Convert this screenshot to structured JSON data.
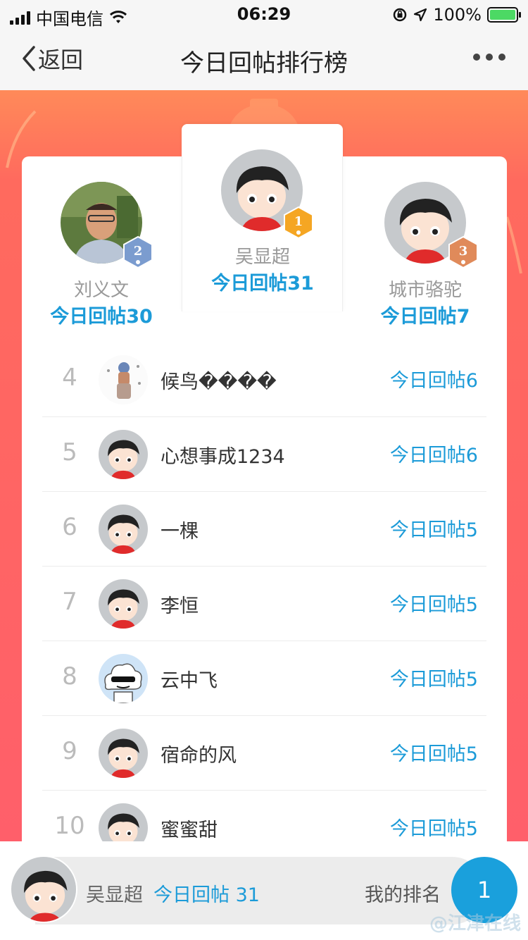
{
  "status_bar": {
    "carrier": "中国电信",
    "time": "06:29",
    "battery": "100%"
  },
  "nav": {
    "back_label": "返回",
    "title": "今日回帖排行榜"
  },
  "top3": [
    {
      "rank": "1",
      "name": "吴显超",
      "count": "今日回帖31"
    },
    {
      "rank": "2",
      "name": "刘义文",
      "count": "今日回帖30"
    },
    {
      "rank": "3",
      "name": "城市骆驼",
      "count": "今日回帖7"
    }
  ],
  "list": [
    {
      "rank": "4",
      "name": "候鸟����",
      "count": "今日回帖6",
      "avatar": "photo"
    },
    {
      "rank": "5",
      "name": "心想事成1234",
      "count": "今日回帖6",
      "avatar": "default"
    },
    {
      "rank": "6",
      "name": "一棵",
      "count": "今日回帖5",
      "avatar": "default"
    },
    {
      "rank": "7",
      "name": "李恒",
      "count": "今日回帖5",
      "avatar": "default"
    },
    {
      "rank": "8",
      "name": "云中飞",
      "count": "今日回帖5",
      "avatar": "cloud"
    },
    {
      "rank": "9",
      "name": "宿命的风",
      "count": "今日回帖5",
      "avatar": "default"
    },
    {
      "rank": "10",
      "name": "蜜蜜甜",
      "count": "今日回帖5",
      "avatar": "default"
    }
  ],
  "me": {
    "name": "吴显超",
    "count": "今日回帖 31",
    "rank_label": "我的排名",
    "rank": "1"
  },
  "watermark": "@江津在线",
  "colors": {
    "accent": "#1c9bd8",
    "background_red": "#ff5f6a",
    "gold_medal": "#f5a623",
    "silver_medal": "#7b9ccf",
    "bronze_medal": "#e08a5a"
  }
}
